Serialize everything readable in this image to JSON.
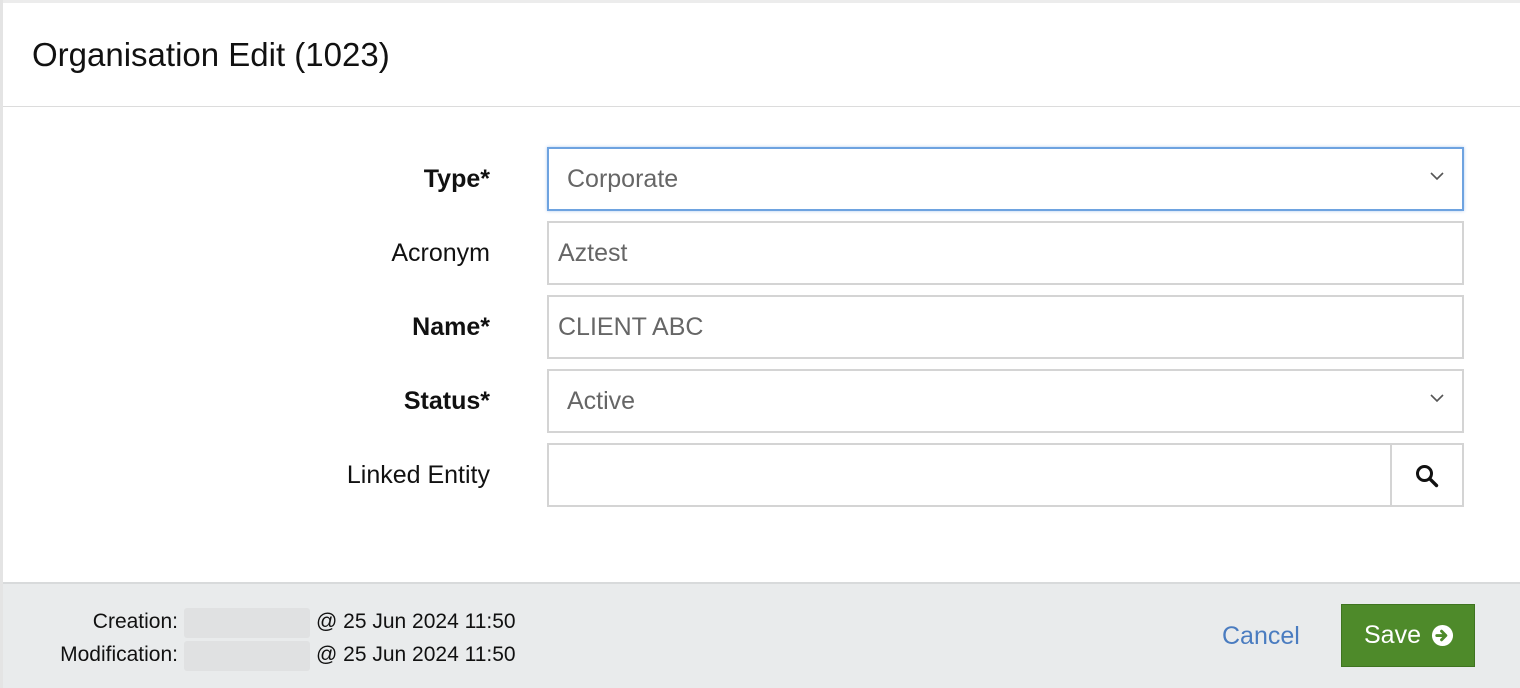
{
  "modal": {
    "title": "Organisation Edit (1023)"
  },
  "form": {
    "type": {
      "label": "Type*",
      "value": "Corporate"
    },
    "acronym": {
      "label": "Acronym",
      "value": "Aztest"
    },
    "name": {
      "label": "Name*",
      "value": "CLIENT ABC"
    },
    "status": {
      "label": "Status*",
      "value": "Active"
    },
    "linked_entity": {
      "label": "Linked Entity",
      "value": "",
      "search_icon": "search-icon"
    }
  },
  "footer": {
    "creation": {
      "label": "Creation:",
      "date": "@ 25 Jun 2024 11:50"
    },
    "modification": {
      "label": "Modification:",
      "date": "@ 25 Jun 2024 11:50"
    },
    "cancel_label": "Cancel",
    "save_label": "Save",
    "save_icon": "arrow-circle-right-icon"
  },
  "colors": {
    "save_button": "#4e8a2a",
    "cancel_link": "#4a7cc0",
    "focus_border": "#6ea3e0",
    "footer_bg": "#e9ebec"
  }
}
